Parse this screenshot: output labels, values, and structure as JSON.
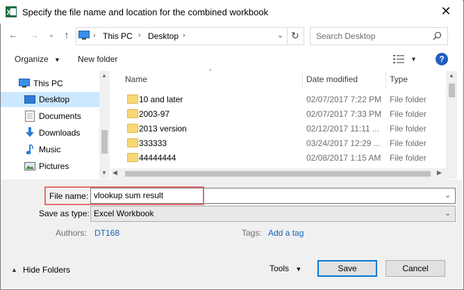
{
  "window": {
    "title": "Specify the file name and location for the combined workbook",
    "close_glyph": "✕"
  },
  "nav": {
    "back_glyph": "←",
    "forward_glyph": "→",
    "recent_glyph": "⌄",
    "up_glyph": "↑",
    "breadcrumb": [
      "This PC",
      "Desktop"
    ],
    "search_placeholder": "Search Desktop",
    "refresh_glyph": "↻"
  },
  "toolbar": {
    "organize_label": "Organize",
    "new_folder_label": "New folder",
    "help_label": "?"
  },
  "sidebar": {
    "items": [
      {
        "label": "This PC",
        "icon": "pc-icon"
      },
      {
        "label": "Desktop",
        "icon": "desktop-icon",
        "selected": true
      },
      {
        "label": "Documents",
        "icon": "documents-icon"
      },
      {
        "label": "Downloads",
        "icon": "downloads-icon"
      },
      {
        "label": "Music",
        "icon": "music-icon"
      },
      {
        "label": "Pictures",
        "icon": "pictures-icon"
      }
    ]
  },
  "files": {
    "columns": [
      "Name",
      "Date modified",
      "Type"
    ],
    "rows": [
      {
        "name": "10 and later",
        "date": "02/07/2017 7:22 PM",
        "type": "File folder"
      },
      {
        "name": "2003-97",
        "date": "02/07/2017 7:33 PM",
        "type": "File folder"
      },
      {
        "name": "2013 version",
        "date": "02/12/2017 11:11 ...",
        "type": "File folder"
      },
      {
        "name": "333333",
        "date": "03/24/2017 12:29 ...",
        "type": "File folder"
      },
      {
        "name": "44444444",
        "date": "02/08/2017 1:15 AM",
        "type": "File folder"
      }
    ]
  },
  "form": {
    "file_name_label": "File name:",
    "file_name_value": "vlookup sum result",
    "save_as_type_label": "Save as type:",
    "save_as_type_value": "Excel Workbook",
    "authors_label": "Authors:",
    "authors_value": "DT168",
    "tags_label": "Tags:",
    "tags_value": "Add a tag"
  },
  "footer": {
    "hide_folders_label": "Hide Folders",
    "tools_label": "Tools",
    "save_label": "Save",
    "cancel_label": "Cancel"
  },
  "colors": {
    "accent": "#0078d7",
    "selection": "#cce8ff",
    "highlight_box": "#e46c6c",
    "link": "#1a5fb4"
  }
}
